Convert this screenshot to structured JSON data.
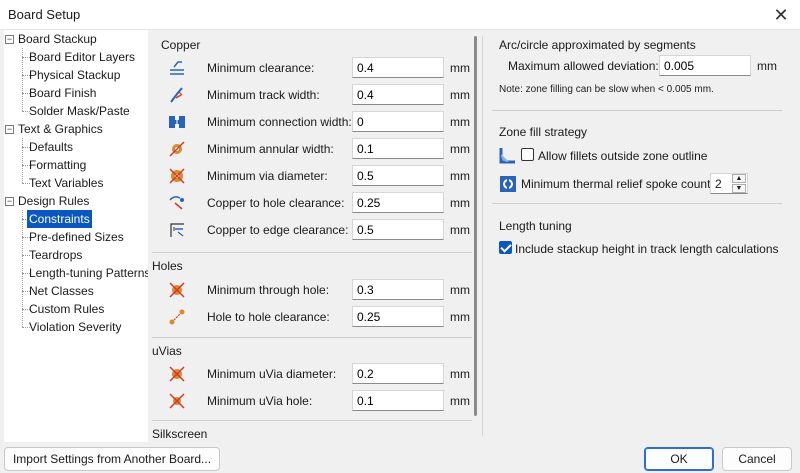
{
  "window": {
    "title": "Board Setup"
  },
  "tree": {
    "groups": [
      {
        "label": "Board Stackup",
        "children": [
          "Board Editor Layers",
          "Physical Stackup",
          "Board Finish",
          "Solder Mask/Paste"
        ]
      },
      {
        "label": "Text & Graphics",
        "children": [
          "Defaults",
          "Formatting",
          "Text Variables"
        ]
      },
      {
        "label": "Design Rules",
        "children": [
          "Constraints",
          "Pre-defined Sizes",
          "Teardrops",
          "Length-tuning Patterns",
          "Net Classes",
          "Custom Rules",
          "Violation Severity"
        ]
      }
    ],
    "selected": "Constraints"
  },
  "copper": {
    "title": "Copper",
    "rows": [
      {
        "label": "Minimum clearance:",
        "value": "0.4",
        "unit": "mm",
        "icon": "clearance-icon"
      },
      {
        "label": "Minimum track width:",
        "value": "0.4",
        "unit": "mm",
        "icon": "track-width-icon"
      },
      {
        "label": "Minimum connection width:",
        "value": "0",
        "unit": "mm",
        "icon": "connection-width-icon"
      },
      {
        "label": "Minimum annular width:",
        "value": "0.1",
        "unit": "mm",
        "icon": "annular-width-icon"
      },
      {
        "label": "Minimum via diameter:",
        "value": "0.5",
        "unit": "mm",
        "icon": "via-diameter-icon"
      },
      {
        "label": "Copper to hole clearance:",
        "value": "0.25",
        "unit": "mm",
        "icon": "hole-clearance-icon"
      },
      {
        "label": "Copper to edge clearance:",
        "value": "0.5",
        "unit": "mm",
        "icon": "edge-clearance-icon"
      }
    ]
  },
  "holes": {
    "title": "Holes",
    "rows": [
      {
        "label": "Minimum through hole:",
        "value": "0.3",
        "unit": "mm",
        "icon": "through-hole-icon"
      },
      {
        "label": "Hole to hole clearance:",
        "value": "0.25",
        "unit": "mm",
        "icon": "hole-to-hole-icon"
      }
    ]
  },
  "uvias": {
    "title": "uVias",
    "rows": [
      {
        "label": "Minimum uVia diameter:",
        "value": "0.2",
        "unit": "mm",
        "icon": "uvia-diameter-icon"
      },
      {
        "label": "Minimum uVia hole:",
        "value": "0.1",
        "unit": "mm",
        "icon": "uvia-hole-icon"
      }
    ]
  },
  "silkscreen": {
    "title": "Silkscreen"
  },
  "arc": {
    "title": "Arc/circle approximated by segments",
    "label": "Maximum allowed deviation:",
    "value": "0.005",
    "unit": "mm",
    "note": "Note: zone filling can be slow when < 0.005 mm."
  },
  "zone": {
    "title": "Zone fill strategy",
    "fillets_label": "Allow fillets outside zone outline",
    "fillets_checked": false,
    "spoke_label": "Minimum thermal relief spoke count:",
    "spoke_value": "2"
  },
  "length": {
    "title": "Length tuning",
    "stackup_label": "Include stackup height in track length calculations",
    "stackup_checked": true
  },
  "buttons": {
    "import": "Import Settings from Another Board...",
    "ok": "OK",
    "cancel": "Cancel"
  },
  "colors": {
    "accent": "#0a57c2",
    "icon_red": "#d33a2c",
    "icon_blue": "#2a64b8"
  }
}
